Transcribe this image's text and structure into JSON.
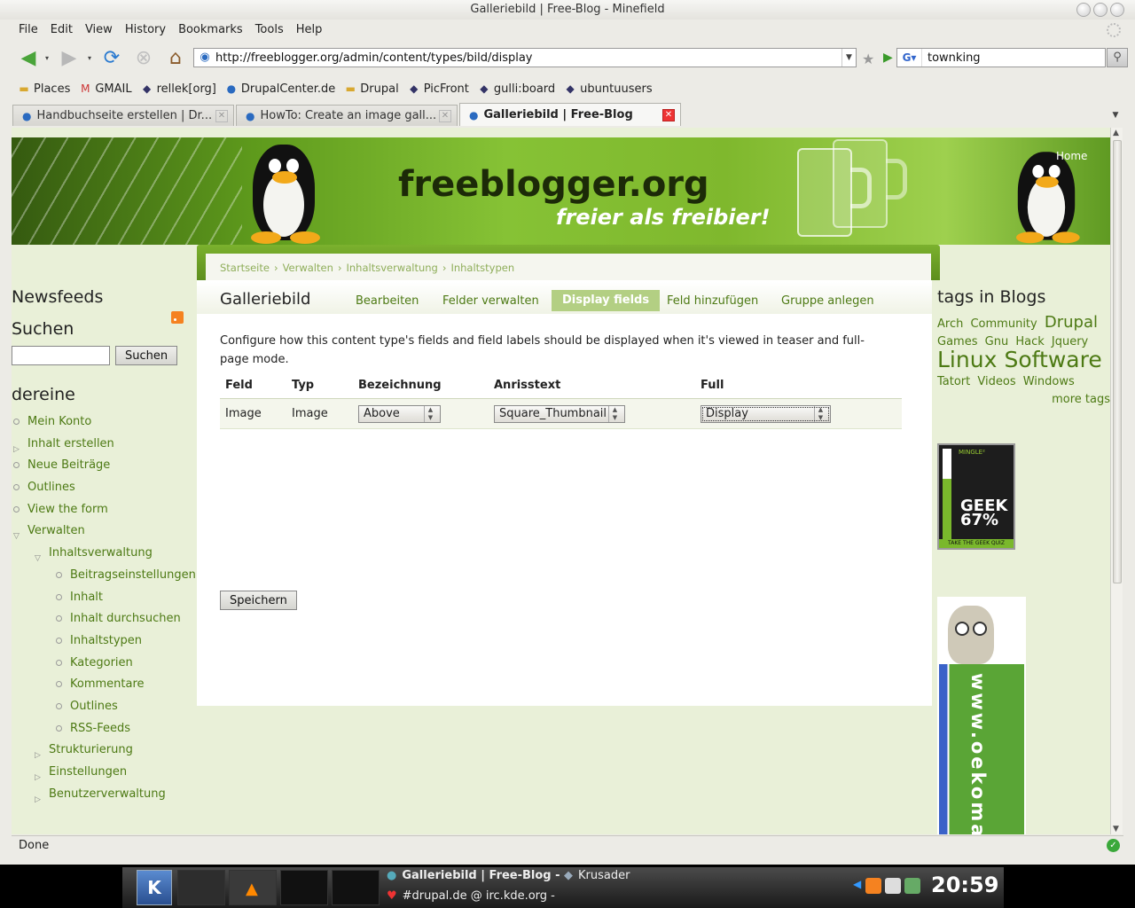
{
  "window": {
    "title": "Galleriebild | Free-Blog - Minefield"
  },
  "menubar": [
    "File",
    "Edit",
    "View",
    "History",
    "Bookmarks",
    "Tools",
    "Help"
  ],
  "navigation": {
    "url": "http://freeblogger.org/admin/content/types/bild/display",
    "search_value": "townking",
    "search_engine_icon": "google-icon"
  },
  "bookmarks": [
    {
      "label": "Places",
      "icon": "folder-icon"
    },
    {
      "label": "GMAIL",
      "icon": "gmail-icon"
    },
    {
      "label": "rellek[org]",
      "icon": "site-icon"
    },
    {
      "label": "DrupalCenter.de",
      "icon": "drupal-icon"
    },
    {
      "label": "Drupal",
      "icon": "folder-icon"
    },
    {
      "label": "PicFront",
      "icon": "site-icon"
    },
    {
      "label": "gulli:board",
      "icon": "site-icon"
    },
    {
      "label": "ubuntuusers",
      "icon": "site-icon"
    }
  ],
  "tabs": [
    {
      "label": "Handbuchseite erstellen | Dr...",
      "active": false
    },
    {
      "label": "HowTo: Create an image gall...",
      "active": false
    },
    {
      "label": "Galleriebild | Free-Blog",
      "active": true
    }
  ],
  "banner": {
    "site_name": "freeblogger.org",
    "slogan": "freier als freibier!",
    "home_link": "Home"
  },
  "breadcrumb": [
    "Startseite",
    "Verwalten",
    "Inhaltsverwaltung",
    "Inhaltstypen"
  ],
  "breadcrumb_sep": "›",
  "sidebar_left": {
    "newsfeeds_title": "Newsfeeds",
    "search_title": "Suchen",
    "search_button": "Suchen",
    "user_title": "dereine",
    "menu": [
      {
        "label": "Mein Konto",
        "level": 0,
        "type": "leaf"
      },
      {
        "label": "Inhalt erstellen",
        "level": 0,
        "type": "collapsed"
      },
      {
        "label": "Neue Beiträge",
        "level": 0,
        "type": "leaf"
      },
      {
        "label": "Outlines",
        "level": 0,
        "type": "leaf"
      },
      {
        "label": "View the form",
        "level": 0,
        "type": "leaf"
      },
      {
        "label": "Verwalten",
        "level": 0,
        "type": "expanded"
      },
      {
        "label": "Inhaltsverwaltung",
        "level": 1,
        "type": "expanded"
      },
      {
        "label": "Beitragseinstellungen",
        "level": 2,
        "type": "leaf"
      },
      {
        "label": "Inhalt",
        "level": 2,
        "type": "leaf"
      },
      {
        "label": "Inhalt durchsuchen",
        "level": 2,
        "type": "leaf"
      },
      {
        "label": "Inhaltstypen",
        "level": 2,
        "type": "leaf"
      },
      {
        "label": "Kategorien",
        "level": 2,
        "type": "leaf"
      },
      {
        "label": "Kommentare",
        "level": 2,
        "type": "leaf"
      },
      {
        "label": "Outlines",
        "level": 2,
        "type": "leaf"
      },
      {
        "label": "RSS-Feeds",
        "level": 2,
        "type": "leaf"
      },
      {
        "label": "Strukturierung",
        "level": 1,
        "type": "collapsed"
      },
      {
        "label": "Einstellungen",
        "level": 1,
        "type": "collapsed"
      },
      {
        "label": "Benutzerverwaltung",
        "level": 1,
        "type": "collapsed"
      }
    ]
  },
  "main": {
    "title": "Galleriebild",
    "local_tabs": [
      {
        "label": "Bearbeiten",
        "active": false
      },
      {
        "label": "Felder verwalten",
        "active": false
      },
      {
        "label": "Display fields",
        "active": true
      },
      {
        "label": "Feld hinzufügen",
        "active": false
      },
      {
        "label": "Gruppe anlegen",
        "active": false
      }
    ],
    "description": "Configure how this content type's fields and field labels should be displayed when it's viewed in teaser and full-page mode.",
    "table": {
      "headers": [
        "Feld",
        "Typ",
        "Bezeichnung",
        "Anrisstext",
        "Full"
      ],
      "rows": [
        {
          "field": "Image",
          "type": "Image",
          "label": "Above",
          "teaser": "Square_Thumbnail",
          "full": "Display"
        }
      ]
    },
    "save_button": "Speichern"
  },
  "sidebar_right": {
    "tags_title": "tags in Blogs",
    "tags": [
      {
        "label": "Arch",
        "size": 1
      },
      {
        "label": "Community",
        "size": 1
      },
      {
        "label": "Drupal",
        "size": 3
      },
      {
        "label": "Games",
        "size": 1
      },
      {
        "label": "Gnu",
        "size": 1
      },
      {
        "label": "Hack",
        "size": 1
      },
      {
        "label": "Jquery",
        "size": 1
      },
      {
        "label": "Linux",
        "size": 4
      },
      {
        "label": "Software",
        "size": 4
      },
      {
        "label": "Tatort",
        "size": 1
      },
      {
        "label": "Videos",
        "size": 1
      },
      {
        "label": "Windows",
        "size": 1
      }
    ],
    "more_tags": "more tags",
    "geek_badge": {
      "brand": "MINGLE²",
      "line1": "GEEK",
      "line2": "67%",
      "footer": "TAKE THE GEEK QUIZ",
      "level": 0.67
    },
    "oeko_banner": "www.oekoman.d"
  },
  "statusbar": {
    "text": "Done"
  },
  "taskbar": {
    "tasks": [
      {
        "label": "Galleriebild | Free-Blog -",
        "active": true
      },
      {
        "label": "Krusader",
        "active": false
      },
      {
        "label": "#drupal.de @ irc.kde.org -",
        "active": false
      }
    ],
    "clock": "20:59"
  },
  "colors": {
    "link": "#4d7a14",
    "banner_green": "#7fb82d",
    "active_tab": "#b3cf83"
  }
}
